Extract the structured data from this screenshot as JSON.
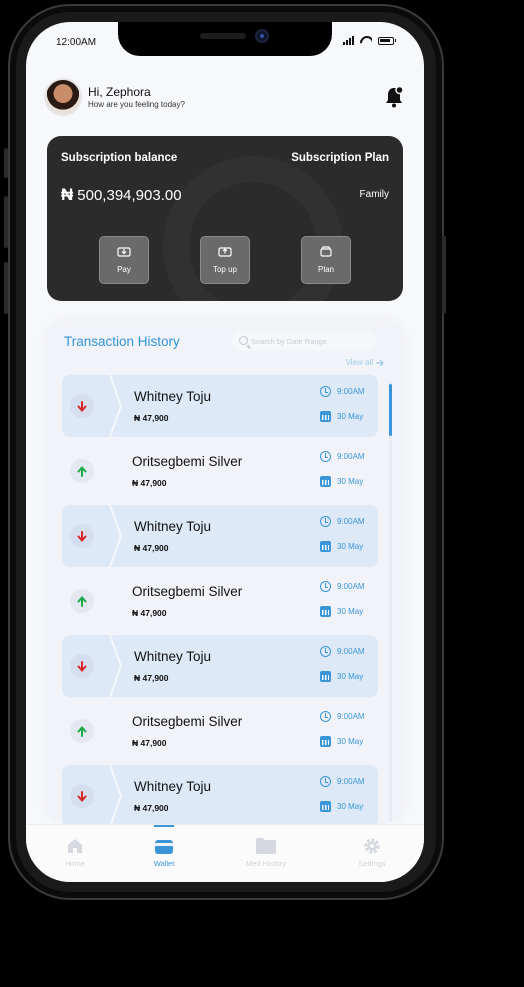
{
  "status_bar": {
    "time": "12:00AM"
  },
  "header": {
    "greeting": "Hi, Zephora",
    "subtitle": "How are you feeling today?"
  },
  "balance_card": {
    "balance_label": "Subscription balance",
    "plan_label": "Subscription Plan",
    "currency_symbol": "₦",
    "amount": "500,394,903.00",
    "plan_value": "Family",
    "actions": [
      {
        "label": "Pay"
      },
      {
        "label": "Top up"
      },
      {
        "label": "Plan"
      }
    ]
  },
  "transactions": {
    "title": "Transaction History",
    "search_placeholder": "Search by Date Range",
    "view_all": "View all",
    "items": [
      {
        "type": "debit",
        "name": "Whitney Toju",
        "amount": "₦ 47,900",
        "time": "9:00AM",
        "date": "30 May"
      },
      {
        "type": "credit",
        "name": "Oritsegbemi Silver",
        "amount": "₦ 47,900",
        "time": "9:00AM",
        "date": "30 May"
      },
      {
        "type": "debit",
        "name": "Whitney Toju",
        "amount": "₦ 47,900",
        "time": "9:00AM",
        "date": "30 May"
      },
      {
        "type": "credit",
        "name": "Oritsegbemi Silver",
        "amount": "₦ 47,900",
        "time": "9:00AM",
        "date": "30 May"
      },
      {
        "type": "debit",
        "name": "Whitney Toju",
        "amount": "₦ 47,900",
        "time": "9:00AM",
        "date": "30 May"
      },
      {
        "type": "credit",
        "name": "Oritsegbemi Silver",
        "amount": "₦ 47,900",
        "time": "9:00AM",
        "date": "30 May"
      },
      {
        "type": "debit",
        "name": "Whitney Toju",
        "amount": "₦ 47,900",
        "time": "9:00AM",
        "date": "30 May"
      }
    ]
  },
  "tabbar": {
    "tabs": [
      {
        "label": "Home",
        "icon": "home-icon",
        "active": false
      },
      {
        "label": "Wallet",
        "icon": "wallet-icon",
        "active": true
      },
      {
        "label": "Med History",
        "icon": "folder-icon",
        "active": false
      },
      {
        "label": "Settings",
        "icon": "gear-icon",
        "active": false
      }
    ]
  },
  "colors": {
    "accent": "#3a96d8",
    "card_bg": "#2b2b2b",
    "debit_arrow": "#d62828",
    "credit_arrow": "#1faa4a",
    "debit_row_bg": "#dde9f6"
  }
}
